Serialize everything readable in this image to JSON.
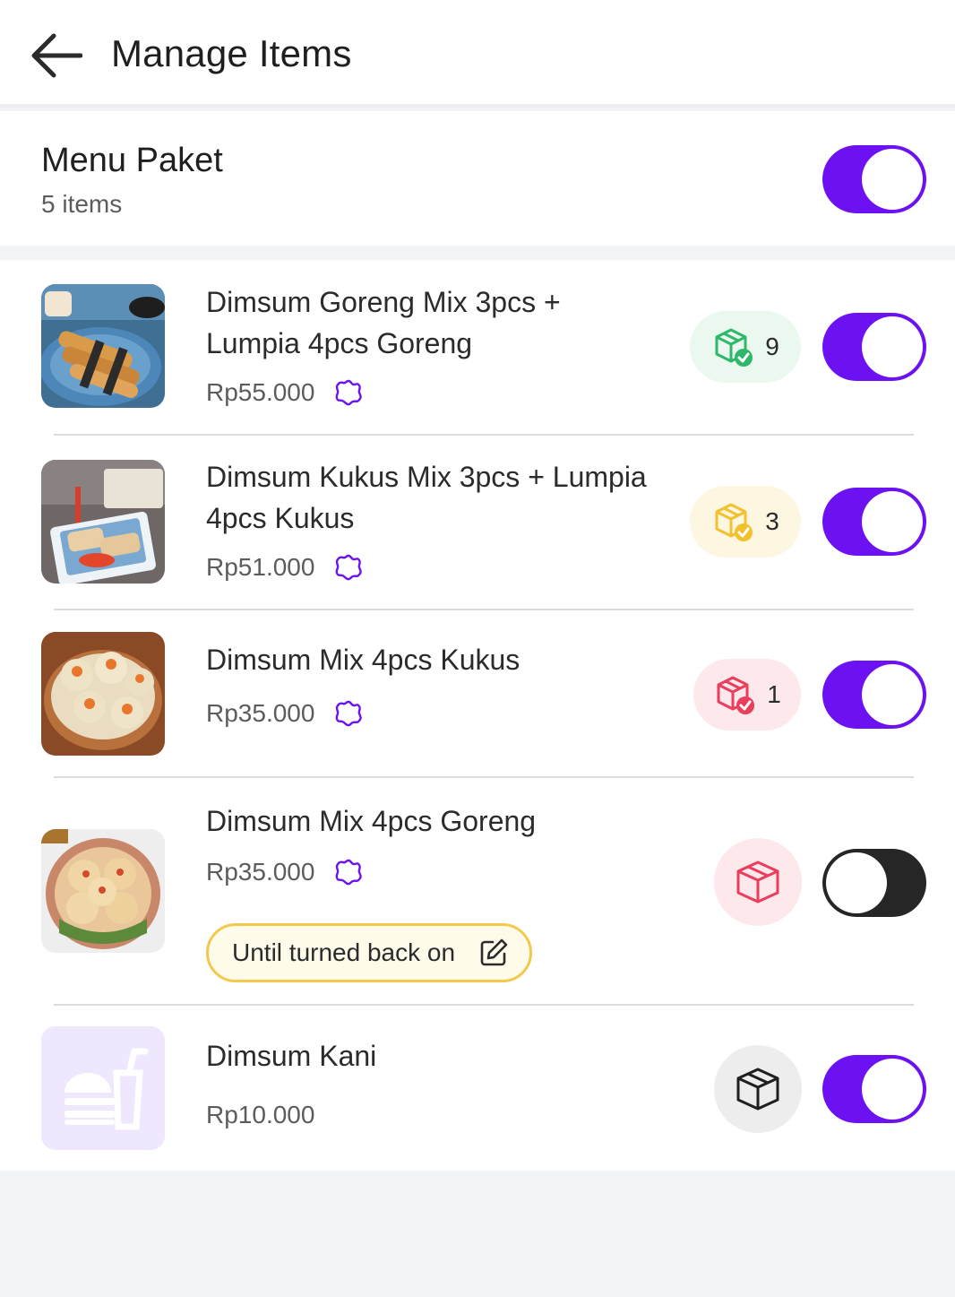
{
  "header": {
    "title": "Manage Items",
    "back_icon": "arrow-left-icon"
  },
  "category": {
    "title": "Menu Paket",
    "count": "5 items",
    "enabled": true
  },
  "items": [
    {
      "name_line1": "Dimsum Goreng Mix 3pcs +",
      "name_line2": "Lumpia 4pcs Goreng",
      "price": "Rp55.000",
      "has_variant": true,
      "stock_count": "9",
      "stock_status": "in-stock",
      "enabled": true
    },
    {
      "name_line1": "Dimsum Kukus Mix 3pcs + Lumpia",
      "name_line2": "4pcs Kukus",
      "price": "Rp51.000",
      "has_variant": true,
      "stock_count": "3",
      "stock_status": "low-stock",
      "enabled": true
    },
    {
      "name_line1": "Dimsum Mix 4pcs Kukus",
      "price": "Rp35.000",
      "has_variant": true,
      "stock_count": "1",
      "stock_status": "critical-stock",
      "enabled": true
    },
    {
      "name_line1": "Dimsum Mix 4pcs Goreng",
      "price": "Rp35.000",
      "has_variant": true,
      "stock_status": "out-of-stock",
      "off_label": "Until turned back on",
      "enabled": false
    },
    {
      "name_line1": "Dimsum Kani",
      "price": "Rp10.000",
      "has_variant": false,
      "stock_status": "untracked",
      "enabled": true
    }
  ],
  "colors": {
    "accent": "#6c12f2",
    "toggle_off": "#262626",
    "stock_green": "#2fb86a",
    "stock_yellow": "#f2c12e",
    "stock_red": "#ea3e5c",
    "pill_border": "#f2c94c"
  }
}
